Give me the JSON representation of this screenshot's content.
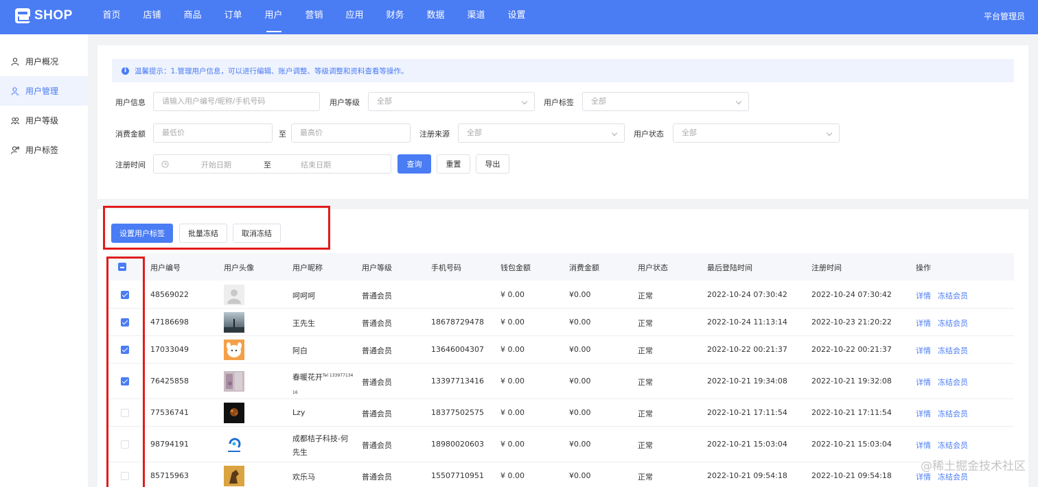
{
  "app": {
    "logo": "SHOP",
    "admin": "平台管理员"
  },
  "nav": [
    "首页",
    "店铺",
    "商品",
    "订单",
    "用户",
    "营销",
    "应用",
    "财务",
    "数据",
    "渠道",
    "设置"
  ],
  "nav_active": 4,
  "sidebar": [
    {
      "label": "用户概况",
      "icon": "user-icon"
    },
    {
      "label": "用户管理",
      "icon": "user-manage-icon"
    },
    {
      "label": "用户等级",
      "icon": "users-icon"
    },
    {
      "label": "用户标签",
      "icon": "user-tag-icon"
    }
  ],
  "sidebar_active": 1,
  "tip": "温馨提示：1.管理用户信息，可以进行编辑、账户调整、等级调整和资料查看等操作。",
  "filters": {
    "user_info_label": "用户信息",
    "user_info_placeholder": "请输入用户编号/昵称/手机号码",
    "level_label": "用户等级",
    "level_value": "全部",
    "tag_label": "用户标签",
    "tag_value": "全部",
    "amount_label": "消费金额",
    "amount_min_placeholder": "最低价",
    "amount_to": "至",
    "amount_max_placeholder": "最高价",
    "source_label": "注册来源",
    "source_value": "全部",
    "status_label": "用户状态",
    "status_value": "全部",
    "reg_time_label": "注册时间",
    "start_date_placeholder": "开始日期",
    "date_to": "至",
    "end_date_placeholder": "结束日期",
    "search_btn": "查询",
    "reset_btn": "重置",
    "export_btn": "导出"
  },
  "batch": {
    "set_tag": "设置用户标签",
    "freeze": "批量冻结",
    "unfreeze": "取消冻结"
  },
  "table": {
    "headers": [
      "用户编号",
      "用户头像",
      "用户昵称",
      "用户等级",
      "手机号码",
      "钱包金额",
      "消费金额",
      "用户状态",
      "最后登陆时间",
      "注册时间",
      "操作"
    ],
    "rows": [
      {
        "checked": true,
        "id": "48569022",
        "avatar": "default",
        "nick": "呵呵呵",
        "level": "普通会员",
        "phone": "",
        "wallet": "¥ 0.00",
        "spent": "¥0.00",
        "status": "正常",
        "last_login": "2022-10-24 07:30:42",
        "reg_time": "2022-10-24 07:30:42",
        "op1": "详情",
        "op2": "冻结会员"
      },
      {
        "checked": true,
        "id": "47186698",
        "avatar": "landscape",
        "nick": "王先生",
        "level": "普通会员",
        "phone": "18678729478",
        "wallet": "¥ 0.00",
        "spent": "¥0.00",
        "status": "正常",
        "last_login": "2022-10-24 11:13:14",
        "reg_time": "2022-10-23 21:20:22",
        "op1": "详情",
        "op2": "冻结会员"
      },
      {
        "checked": true,
        "id": "17033049",
        "avatar": "cartoon",
        "nick": "阿白",
        "level": "普通会员",
        "phone": "13646004307",
        "wallet": "¥ 0.00",
        "spent": "¥0.00",
        "status": "正常",
        "last_login": "2022-10-22 00:21:37",
        "reg_time": "2022-10-22 00:21:37",
        "op1": "详情",
        "op2": "冻结会员"
      },
      {
        "checked": true,
        "id": "76425858",
        "avatar": "flowers",
        "nick": "春暖花开",
        "nick_sup": "Tel 133977134",
        "nick_line2": "16",
        "level": "普通会员",
        "phone": "13397713416",
        "wallet": "¥ 0.00",
        "spent": "¥0.00",
        "status": "正常",
        "last_login": "2022-10-21 19:34:08",
        "reg_time": "2022-10-21 19:32:08",
        "op1": "详情",
        "op2": "冻结会员"
      },
      {
        "checked": false,
        "id": "77536741",
        "avatar": "dark",
        "nick": "Lzy",
        "level": "普通会员",
        "phone": "18377502575",
        "wallet": "¥ 0.00",
        "spent": "¥0.00",
        "status": "正常",
        "last_login": "2022-10-21 17:11:54",
        "reg_time": "2022-10-21 17:11:54",
        "op1": "详情",
        "op2": "冻结会员"
      },
      {
        "checked": false,
        "id": "98794191",
        "avatar": "logo",
        "nick": "成都桔子科技-何",
        "nick_line2": "先生",
        "level": "普通会员",
        "phone": "18980020603",
        "wallet": "¥ 0.00",
        "spent": "¥0.00",
        "status": "正常",
        "last_login": "2022-10-21 15:03:04",
        "reg_time": "2022-10-21 15:03:04",
        "op1": "详情",
        "op2": "冻结会员"
      },
      {
        "checked": false,
        "id": "85715963",
        "avatar": "horse",
        "nick": "欢乐马",
        "level": "普通会员",
        "phone": "15507710951",
        "wallet": "¥ 0.00",
        "spent": "¥0.00",
        "status": "正常",
        "last_login": "2022-10-21 09:54:18",
        "reg_time": "2022-10-21 09:54:18",
        "op1": "详情",
        "op2": "冻结会员"
      }
    ]
  },
  "watermark": "@稀土掘金技术社区",
  "colors": {
    "primary": "#4a7cf4",
    "highlight": "#e11b1b"
  }
}
